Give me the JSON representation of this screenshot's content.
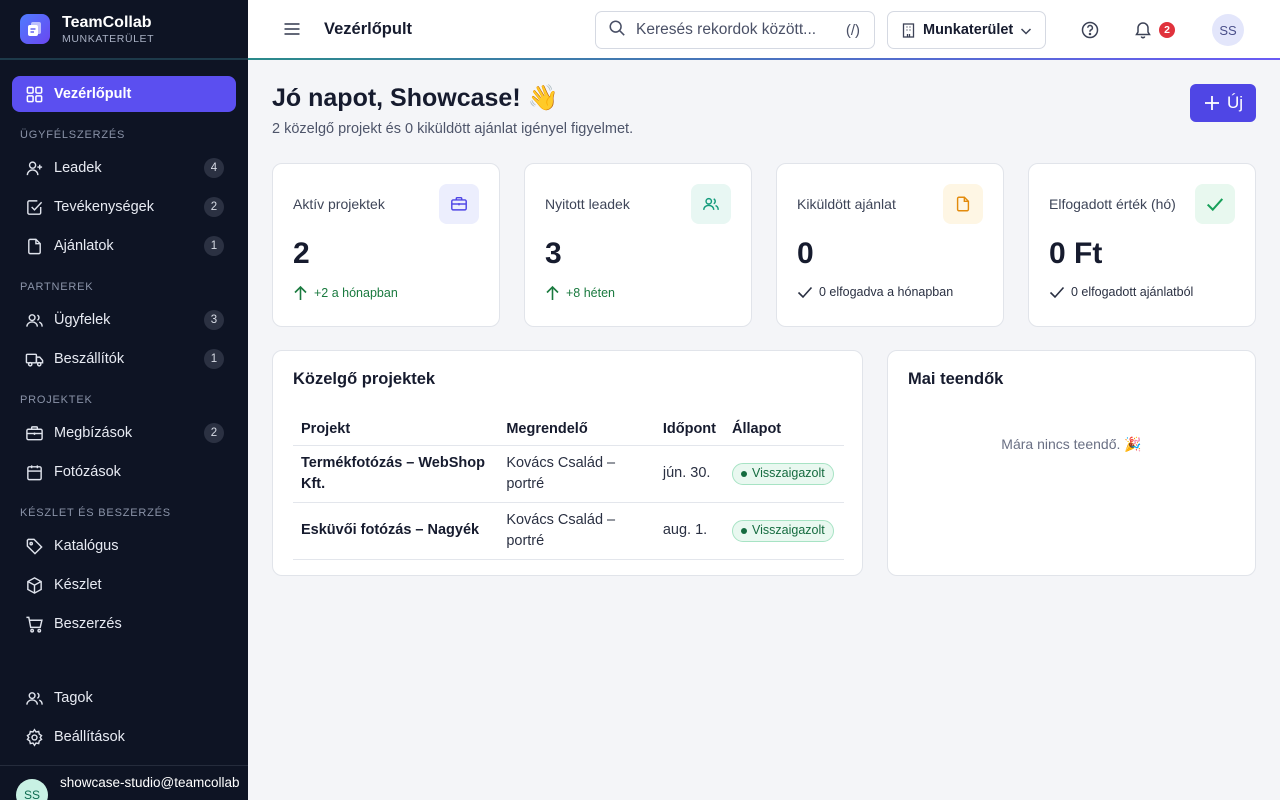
{
  "brand": {
    "name": "TeamCollab",
    "subtitle": "MUNKATERÜLET"
  },
  "sidebar": {
    "dashboard": {
      "label": "Vezérlőpult"
    },
    "sections": [
      {
        "title": "ÜGYFÉLSZERZÉS",
        "items": [
          {
            "label": "Leadek",
            "count": "4",
            "icon": "user-plus-icon"
          },
          {
            "label": "Tevékenységek",
            "count": "2",
            "icon": "checkbox-icon"
          },
          {
            "label": "Ajánlatok",
            "count": "1",
            "icon": "document-icon"
          }
        ]
      },
      {
        "title": "PARTNEREK",
        "items": [
          {
            "label": "Ügyfelek",
            "count": "3",
            "icon": "users-icon"
          },
          {
            "label": "Beszállítók",
            "count": "1",
            "icon": "truck-icon"
          }
        ]
      },
      {
        "title": "PROJEKTEK",
        "items": [
          {
            "label": "Megbízások",
            "count": "2",
            "icon": "briefcase-icon"
          },
          {
            "label": "Fotózások",
            "count": "",
            "icon": "calendar-icon"
          }
        ]
      },
      {
        "title": "KÉSZLET ÉS BESZERZÉS",
        "items": [
          {
            "label": "Katalógus",
            "count": "",
            "icon": "tag-icon"
          },
          {
            "label": "Készlet",
            "count": "",
            "icon": "box-icon"
          },
          {
            "label": "Beszerzés",
            "count": "",
            "icon": "cart-icon"
          }
        ]
      }
    ],
    "bottom": [
      {
        "label": "Tagok",
        "icon": "members-icon"
      },
      {
        "label": "Beállítások",
        "icon": "settings-icon"
      }
    ],
    "user": {
      "initials": "SS",
      "email": "showcase-studio@teamcollab"
    }
  },
  "topbar": {
    "title": "Vezérlőpult",
    "search_placeholder": "Keresés rekordok között...",
    "search_shortcut": "(/)",
    "workspace_label": "Munkaterület",
    "notification_count": "2",
    "avatar_initials": "SS"
  },
  "main": {
    "greeting": "Jó napot, Showcase! 👋",
    "subtitle": "2 közelgő projekt és 0 kiküldött ajánlat igényel figyelmet.",
    "new_button": "Új",
    "stats": [
      {
        "label": "Aktív projektek",
        "value": "2",
        "delta": "+2 a hónapban",
        "delta_type": "up",
        "icon": "briefcase-icon",
        "icon_bg": "#eceefd",
        "icon_color": "#4f46e5"
      },
      {
        "label": "Nyitott leadek",
        "value": "3",
        "delta": "+8 héten",
        "delta_type": "up",
        "icon": "users-icon",
        "icon_bg": "#e8f7f3",
        "icon_color": "#149b7c"
      },
      {
        "label": "Kiküldött ajánlat",
        "value": "0",
        "delta": "0 elfogadva a hónapban",
        "delta_type": "check",
        "icon": "document-icon",
        "icon_bg": "#fef6e4",
        "icon_color": "#e38b0c"
      },
      {
        "label": "Elfogadott érték (hó)",
        "value": "0 Ft",
        "delta": "0 elfogadott ajánlatból",
        "delta_type": "check",
        "icon": "check-icon",
        "icon_bg": "#e8f8ef",
        "icon_color": "#17a05a"
      }
    ],
    "upcoming": {
      "title": "Közelgő projektek",
      "columns": [
        "Projekt",
        "Megrendelő",
        "Időpont",
        "Állapot"
      ],
      "rows": [
        {
          "project": "Termékfotózás – WebShop Kft.",
          "client": "Kovács Család – portré",
          "date": "jún. 30.",
          "status": "Visszaigazolt"
        },
        {
          "project": "Esküvői fotózás – Nagyék",
          "client": "Kovács Család – portré",
          "date": "aug. 1.",
          "status": "Visszaigazolt"
        }
      ]
    },
    "todos": {
      "title": "Mai teendők",
      "empty": "Mára nincs teendő. 🎉"
    }
  }
}
